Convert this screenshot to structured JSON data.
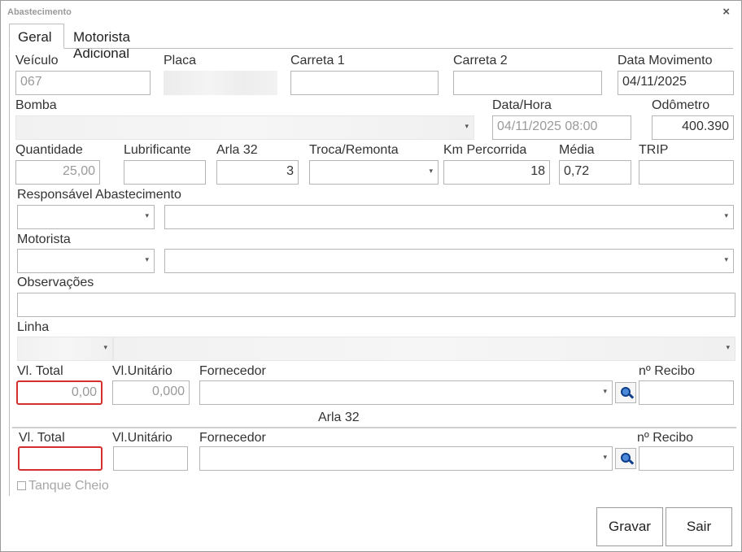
{
  "window": {
    "title": "Abastecimento",
    "close_glyph": "×"
  },
  "tabs": [
    {
      "label": "Geral",
      "active": true
    },
    {
      "label": "Motorista Adicional",
      "active": false
    }
  ],
  "labels": {
    "veiculo": "Veículo",
    "placa": "Placa",
    "carreta1": "Carreta 1",
    "carreta2": "Carreta 2",
    "data_movimento": "Data Movimento",
    "bomba": "Bomba",
    "data_hora": "Data/Hora",
    "odometro": "Odômetro",
    "quantidade": "Quantidade",
    "lubrificante": "Lubrificante",
    "arla32": "Arla 32",
    "troca_remonta": "Troca/Remonta",
    "km_percorrida": "Km Percorrida",
    "media": "Média",
    "trip": "TRIP",
    "responsavel": "Responsável Abastecimento",
    "motorista": "Motorista",
    "observacoes": "Observações",
    "linha": "Linha",
    "vl_total": "Vl. Total",
    "vl_unitario": "Vl.Unitário",
    "fornecedor": "Fornecedor",
    "n_recibo": "nº Recibo"
  },
  "values": {
    "veiculo": "067",
    "data_movimento": "04/11/2025",
    "data_hora": "04/11/2025 08:00",
    "odometro": "400.390",
    "quantidade": "25,00",
    "arla32": "3",
    "km_percorrida": "18",
    "media": "0,72",
    "vl_total": "0,00",
    "vl_unitario": "0,000"
  },
  "arla_section": {
    "title": "Arla 32"
  },
  "checkbox": {
    "tanque_cheio": "Tanque Cheio"
  },
  "buttons": {
    "gravar": "Gravar",
    "sair": "Sair"
  },
  "icons": {
    "dropdown": "chevron-down-icon",
    "lookup": "search-icon"
  },
  "colors": {
    "error_border": "#d32f2f",
    "border": "#b5b5b5",
    "lookup_icon": "#4c88d8"
  }
}
